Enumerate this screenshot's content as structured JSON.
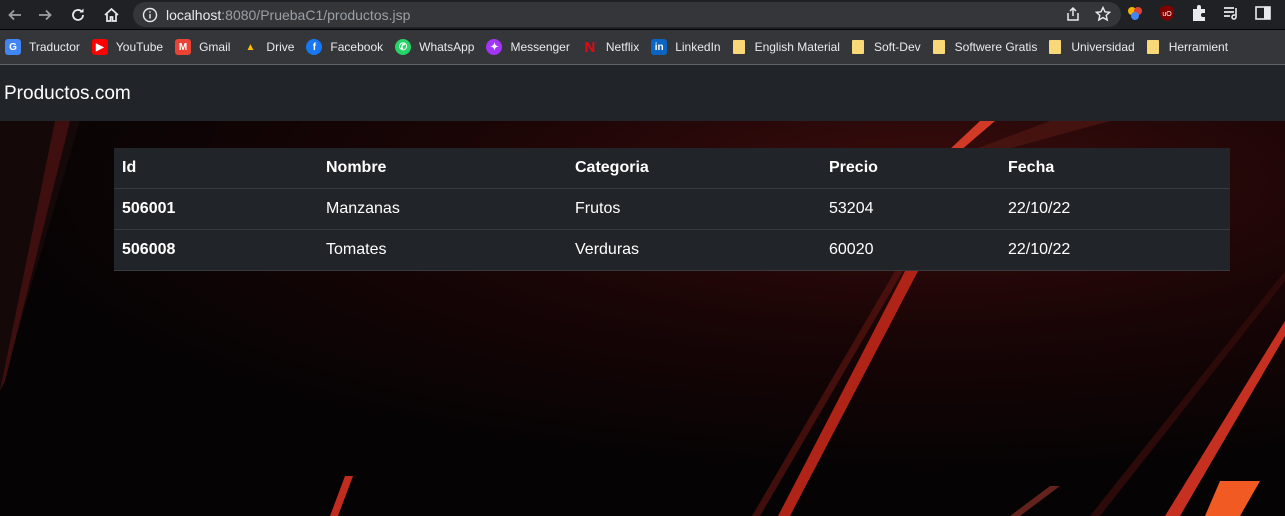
{
  "browser": {
    "url_host": "localhost",
    "url_rest": ":8080/PruebaC1/productos.jsp"
  },
  "bookmarks": [
    {
      "label": "Traductor",
      "icon": "google-translate-icon",
      "color": "#4285f4"
    },
    {
      "label": "YouTube",
      "icon": "youtube-icon",
      "color": "#ff0000"
    },
    {
      "label": "Gmail",
      "icon": "gmail-icon",
      "color": "#ea4335"
    },
    {
      "label": "Drive",
      "icon": "drive-icon",
      "color": "#fbbc04"
    },
    {
      "label": "Facebook",
      "icon": "facebook-icon",
      "color": "#1877f2"
    },
    {
      "label": "WhatsApp",
      "icon": "whatsapp-icon",
      "color": "#25d366"
    },
    {
      "label": "Messenger",
      "icon": "messenger-icon",
      "color": "#a334fa"
    },
    {
      "label": "Netflix",
      "icon": "netflix-icon",
      "color": "#e50914"
    },
    {
      "label": "LinkedIn",
      "icon": "linkedin-icon",
      "color": "#0a66c2"
    },
    {
      "label": "English Material",
      "icon": "folder-icon",
      "color": "#f9d878"
    },
    {
      "label": "Soft-Dev",
      "icon": "folder-icon",
      "color": "#f9d878"
    },
    {
      "label": "Softwere Gratis",
      "icon": "folder-icon",
      "color": "#f9d878"
    },
    {
      "label": "Universidad",
      "icon": "folder-icon",
      "color": "#f9d878"
    },
    {
      "label": "Herramient",
      "icon": "folder-icon",
      "color": "#f9d878"
    }
  ],
  "navbar": {
    "brand": "Productos.com"
  },
  "table": {
    "headers": [
      "Id",
      "Nombre",
      "Categoria",
      "Precio",
      "Fecha"
    ],
    "rows": [
      [
        "506001",
        "Manzanas",
        "Frutos",
        "53204",
        "22/10/22"
      ],
      [
        "506008",
        "Tomates",
        "Verduras",
        "60020",
        "22/10/22"
      ]
    ]
  },
  "colors": {
    "navbar_bg": "#212529",
    "table_bg": "#212529",
    "accent_red": "#c0261b"
  }
}
